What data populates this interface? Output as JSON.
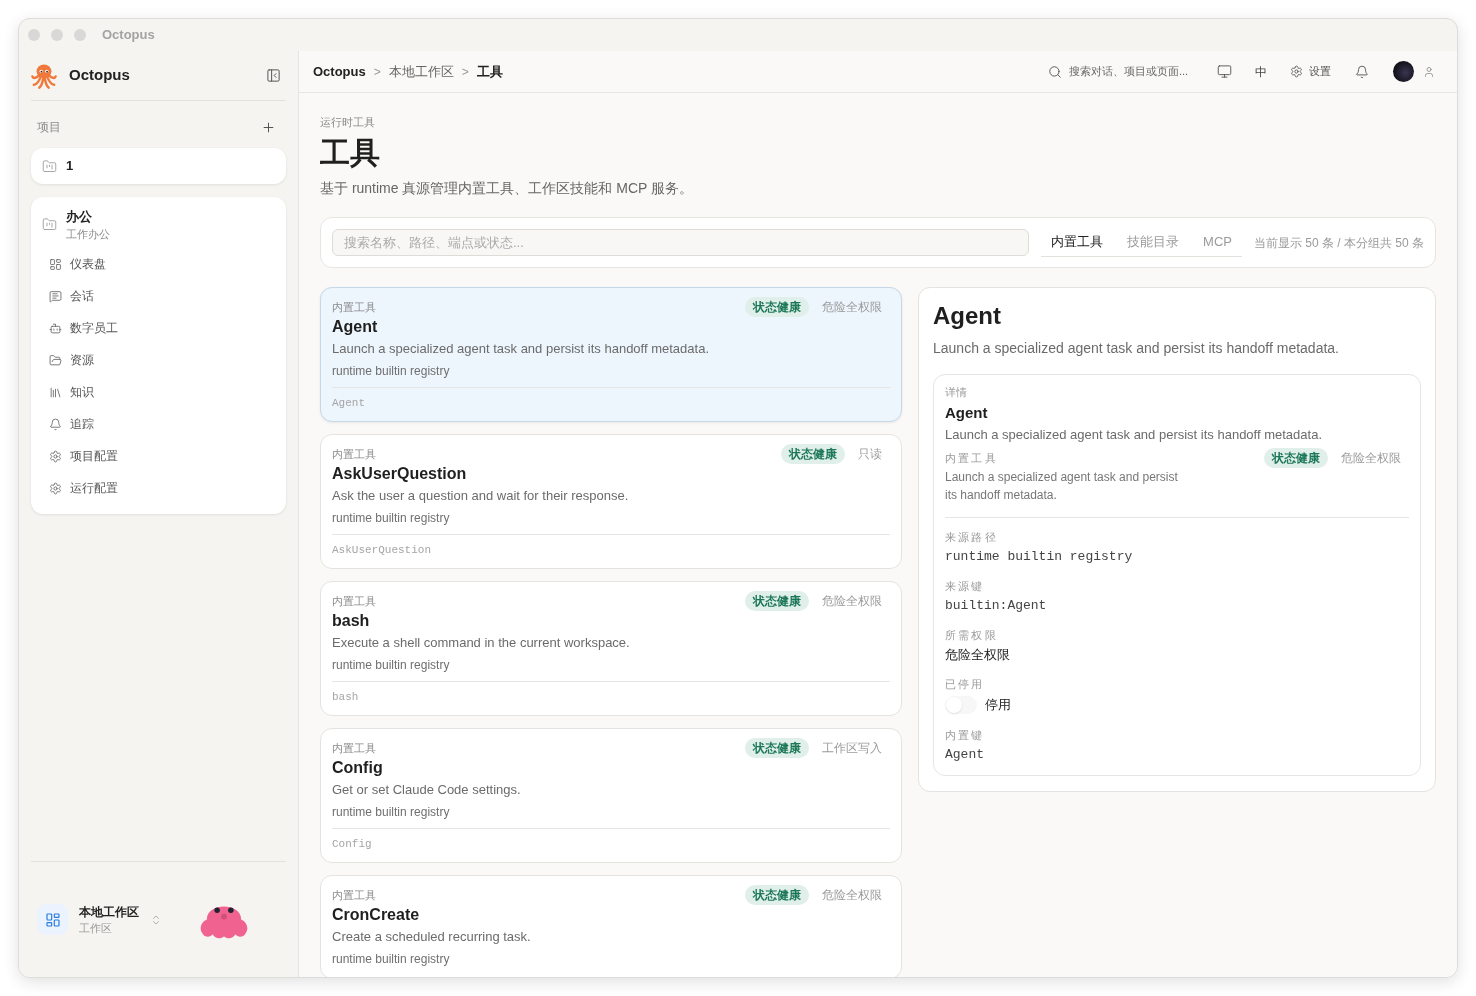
{
  "window": {
    "title": "Octopus"
  },
  "sidebar": {
    "brand": "Octopus",
    "projects_label": "项目",
    "projects": [
      {
        "name": "1"
      },
      {
        "name": "办公",
        "subtitle": "工作办公",
        "items": [
          {
            "label": "仪表盘",
            "selected": false
          },
          {
            "label": "会话",
            "selected": false
          },
          {
            "label": "数字员工",
            "selected": false
          },
          {
            "label": "资源",
            "selected": false
          },
          {
            "label": "知识",
            "selected": false
          },
          {
            "label": "追踪",
            "selected": false
          },
          {
            "label": "项目配置",
            "selected": false
          },
          {
            "label": "运行配置",
            "selected": false
          }
        ]
      }
    ],
    "workspace": {
      "name": "本地工作区",
      "subtitle": "工作区"
    }
  },
  "topbar": {
    "breadcrumb": [
      {
        "kind": "root",
        "text": "Octopus"
      },
      {
        "kind": "separator",
        "text": ">"
      },
      {
        "kind": "link",
        "text": "本地工作区"
      },
      {
        "kind": "separator",
        "text": ">"
      },
      {
        "kind": "current",
        "text": "工具"
      }
    ],
    "search": {
      "placeholder": "搜索对话、项目或页面..."
    },
    "language": "中",
    "settings": "设置"
  },
  "header": {
    "eyebrow": "运行时工具",
    "title": "工具",
    "description": "基于 runtime 真源管理内置工具、工作区技能和 MCP 服务。"
  },
  "toolbar": {
    "filter": {
      "placeholder": "搜索名称、路径、端点或状态..."
    },
    "tabs": [
      {
        "label": "内置工具",
        "selected": true
      },
      {
        "label": "技能目录",
        "selected": false
      },
      {
        "label": "MCP",
        "selected": false
      }
    ],
    "count": "当前显示 50 条 / 本分组共 50 条"
  },
  "tools": [
    {
      "category": "内置工具",
      "status": "状态健康",
      "permission": "危险全权限",
      "name": "Agent",
      "description": "Launch a specialized agent task and persist its handoff metadata.",
      "source": "runtime builtin registry",
      "key": "Agent",
      "selected": true
    },
    {
      "category": "内置工具",
      "status": "状态健康",
      "permission": "只读",
      "name": "AskUserQuestion",
      "description": "Ask the user a question and wait for their response.",
      "source": "runtime builtin registry",
      "key": "AskUserQuestion",
      "selected": false
    },
    {
      "category": "内置工具",
      "status": "状态健康",
      "permission": "危险全权限",
      "name": "bash",
      "description": "Execute a shell command in the current workspace.",
      "source": "runtime builtin registry",
      "key": "bash",
      "selected": false
    },
    {
      "category": "内置工具",
      "status": "状态健康",
      "permission": "工作区写入",
      "name": "Config",
      "description": "Get or set Claude Code settings.",
      "source": "runtime builtin registry",
      "key": "Config",
      "selected": false
    },
    {
      "category": "内置工具",
      "status": "状态健康",
      "permission": "危险全权限",
      "name": "CronCreate",
      "description": "Create a scheduled recurring task.",
      "source": "runtime builtin registry",
      "selected": false
    }
  ],
  "detail": {
    "title": "Agent",
    "description": "Launch a specialized agent task and persist its handoff metadata.",
    "card": {
      "label": "详情",
      "name": "Agent",
      "description": "Launch a specialized agent task and persist its handoff metadata.",
      "category": "内置工具",
      "status": "状态健康",
      "permission": "危险全权限",
      "summary": "Launch a specialized agent task and persist its handoff metadata.",
      "fields": [
        {
          "kind": "mono",
          "label": "来源路径",
          "value": "runtime builtin registry"
        },
        {
          "kind": "mono",
          "label": "来源键",
          "value": "builtin:Agent"
        },
        {
          "kind": "text",
          "label": "所需权限",
          "value": "危险全权限"
        },
        {
          "kind": "toggle",
          "label": "已停用",
          "on": false,
          "value": "停用"
        },
        {
          "kind": "mono",
          "label": "内置键",
          "value": "Agent"
        }
      ]
    }
  }
}
